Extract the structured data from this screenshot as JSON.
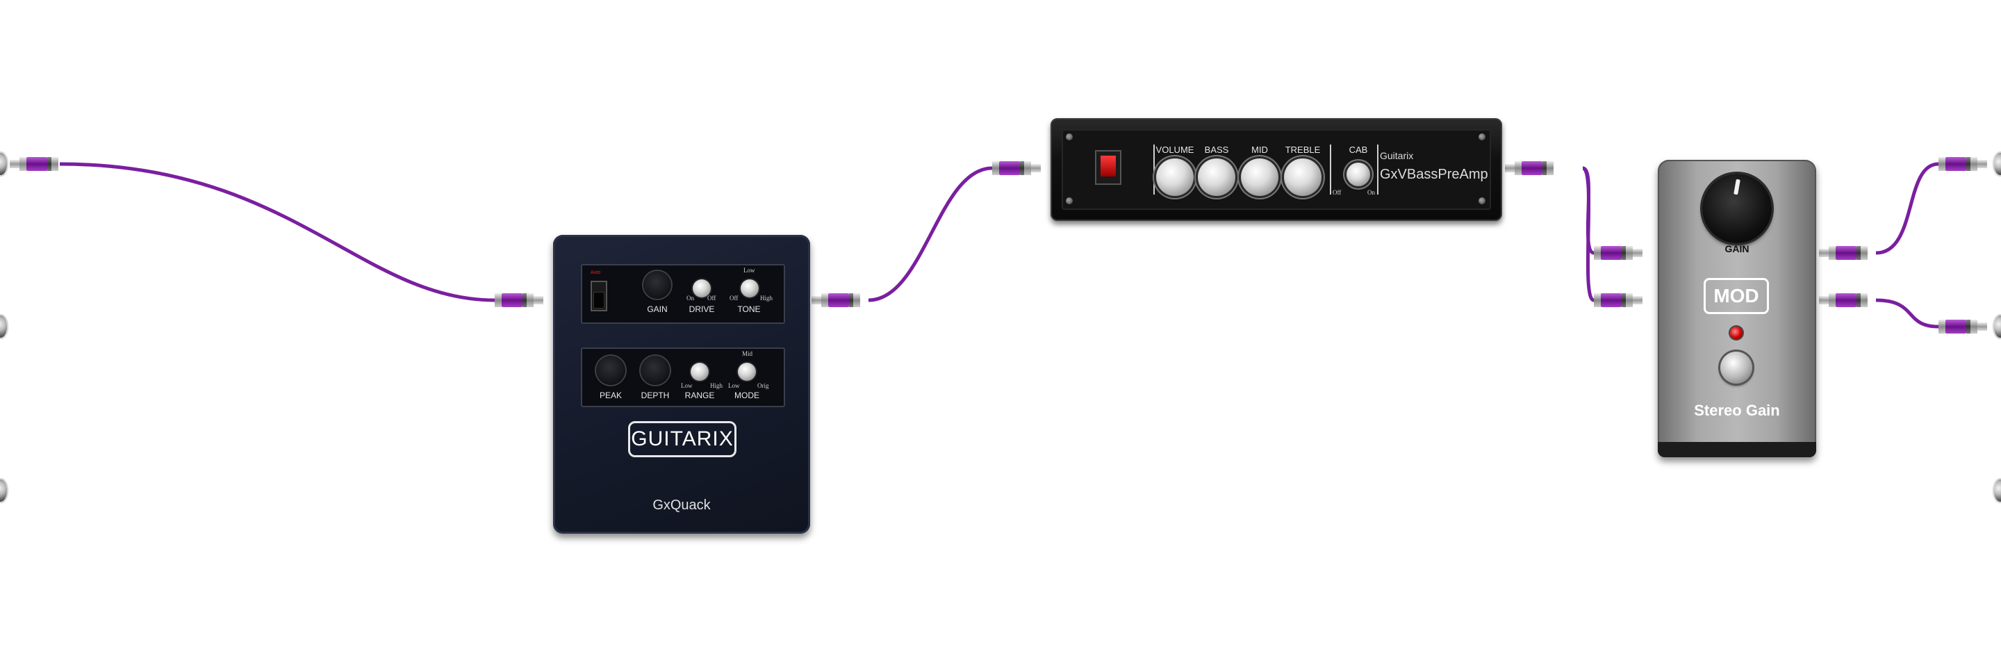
{
  "cable_color": "#7a1fa0",
  "plugins": {
    "gxquack": {
      "name": "GxQuack",
      "brand": "GUITARIX",
      "switch_label": "Auto",
      "panel1": {
        "gain": "GAIN",
        "drive": "DRIVE",
        "tone": "TONE",
        "drive_on": "On",
        "drive_off": "Off",
        "tone_low": "Low",
        "tone_off": "Off",
        "tone_high": "High"
      },
      "panel2": {
        "peak": "PEAK",
        "depth": "DEPTH",
        "range": "RANGE",
        "mode": "MODE",
        "range_low": "Low",
        "range_high": "High",
        "mode_mid": "Mid",
        "mode_low": "Low",
        "mode_orig": "Orig"
      }
    },
    "bassamp": {
      "brand": "Guitarix",
      "name": "GxVBassPreAmp",
      "knobs": [
        "VOLUME",
        "BASS",
        "MID",
        "TREBLE"
      ],
      "cab": "CAB",
      "cab_off": "Off",
      "cab_on": "On"
    },
    "stereogain": {
      "knob_label": "GAIN",
      "logo": "MOD",
      "name": "Stereo Gain",
      "led_color": "#dd0000"
    }
  }
}
